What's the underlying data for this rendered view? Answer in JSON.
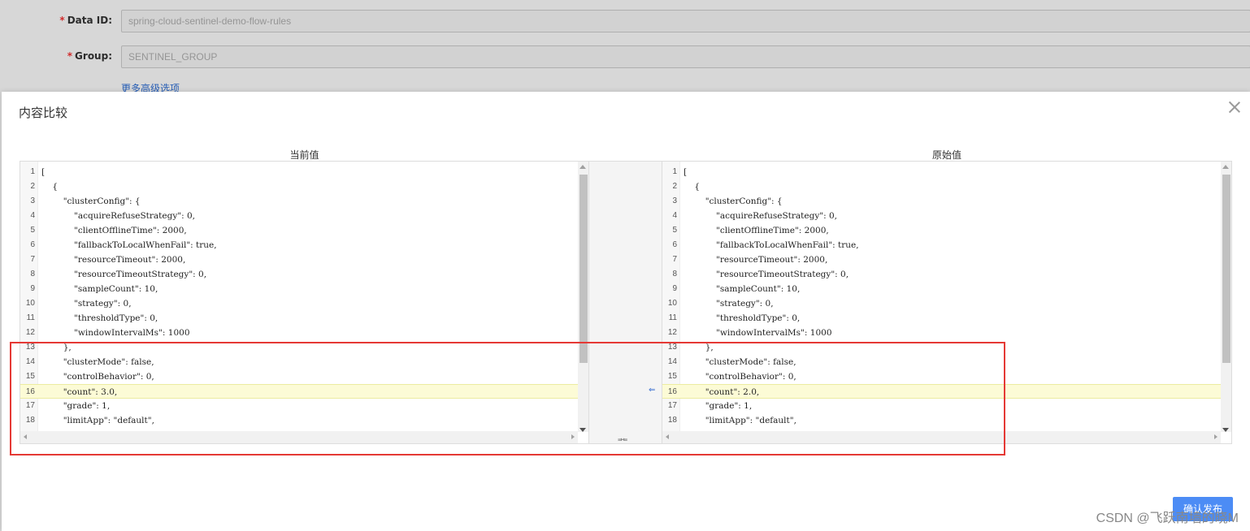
{
  "form": {
    "data_id_label": "Data ID:",
    "data_id_value": "spring-cloud-sentinel-demo-flow-rules",
    "group_label": "Group:",
    "group_value": "SENTINEL_GROUP",
    "required_mark": "*",
    "advanced_link": "更多高级选项"
  },
  "dialog": {
    "title": "内容比较",
    "left_header": "当前值",
    "right_header": "原始值",
    "confirm_button": "确认发布"
  },
  "left_lines": [
    {
      "n": "1",
      "t": "["
    },
    {
      "n": "2",
      "t": "    {"
    },
    {
      "n": "3",
      "t": "        \"clusterConfig\": {"
    },
    {
      "n": "4",
      "t": "            \"acquireRefuseStrategy\": 0,"
    },
    {
      "n": "5",
      "t": "            \"clientOfflineTime\": 2000,"
    },
    {
      "n": "6",
      "t": "            \"fallbackToLocalWhenFail\": true,"
    },
    {
      "n": "7",
      "t": "            \"resourceTimeout\": 2000,"
    },
    {
      "n": "8",
      "t": "            \"resourceTimeoutStrategy\": 0,"
    },
    {
      "n": "9",
      "t": "            \"sampleCount\": 10,"
    },
    {
      "n": "10",
      "t": "            \"strategy\": 0,"
    },
    {
      "n": "11",
      "t": "            \"thresholdType\": 0,"
    },
    {
      "n": "12",
      "t": "            \"windowIntervalMs\": 1000"
    },
    {
      "n": "13",
      "t": "        },"
    },
    {
      "n": "14",
      "t": "        \"clusterMode\": false,"
    },
    {
      "n": "15",
      "t": "        \"controlBehavior\": 0,"
    },
    {
      "n": "16",
      "t": "        \"count\": 3.0,"
    },
    {
      "n": "17",
      "t": "        \"grade\": 1,"
    },
    {
      "n": "18",
      "t": "        \"limitApp\": \"default\","
    }
  ],
  "right_lines": [
    {
      "n": "1",
      "t": "["
    },
    {
      "n": "2",
      "t": "    {"
    },
    {
      "n": "3",
      "t": "        \"clusterConfig\": {"
    },
    {
      "n": "4",
      "t": "            \"acquireRefuseStrategy\": 0,"
    },
    {
      "n": "5",
      "t": "            \"clientOfflineTime\": 2000,"
    },
    {
      "n": "6",
      "t": "            \"fallbackToLocalWhenFail\": true,"
    },
    {
      "n": "7",
      "t": "            \"resourceTimeout\": 2000,"
    },
    {
      "n": "8",
      "t": "            \"resourceTimeoutStrategy\": 0,"
    },
    {
      "n": "9",
      "t": "            \"sampleCount\": 10,"
    },
    {
      "n": "10",
      "t": "            \"strategy\": 0,"
    },
    {
      "n": "11",
      "t": "            \"thresholdType\": 0,"
    },
    {
      "n": "12",
      "t": "            \"windowIntervalMs\": 1000"
    },
    {
      "n": "13",
      "t": "        },"
    },
    {
      "n": "14",
      "t": "        \"clusterMode\": false,"
    },
    {
      "n": "15",
      "t": "        \"controlBehavior\": 0,"
    },
    {
      "n": "16",
      "t": "        \"count\": 2.0,"
    },
    {
      "n": "17",
      "t": "        \"grade\": 1,"
    },
    {
      "n": "18",
      "t": "        \"limitApp\": \"default\","
    }
  ],
  "highlight_line": "16",
  "merge": {
    "arrow_icon": "⇐",
    "bottom_icons": "⇛⇚"
  },
  "watermark": "CSDN @飞跃南墙的晓M",
  "colors": {
    "accent": "#4c8cf5",
    "highlight_bg": "#fcfbd6",
    "annotation_red": "#e53935",
    "link": "#2d6bcf"
  }
}
